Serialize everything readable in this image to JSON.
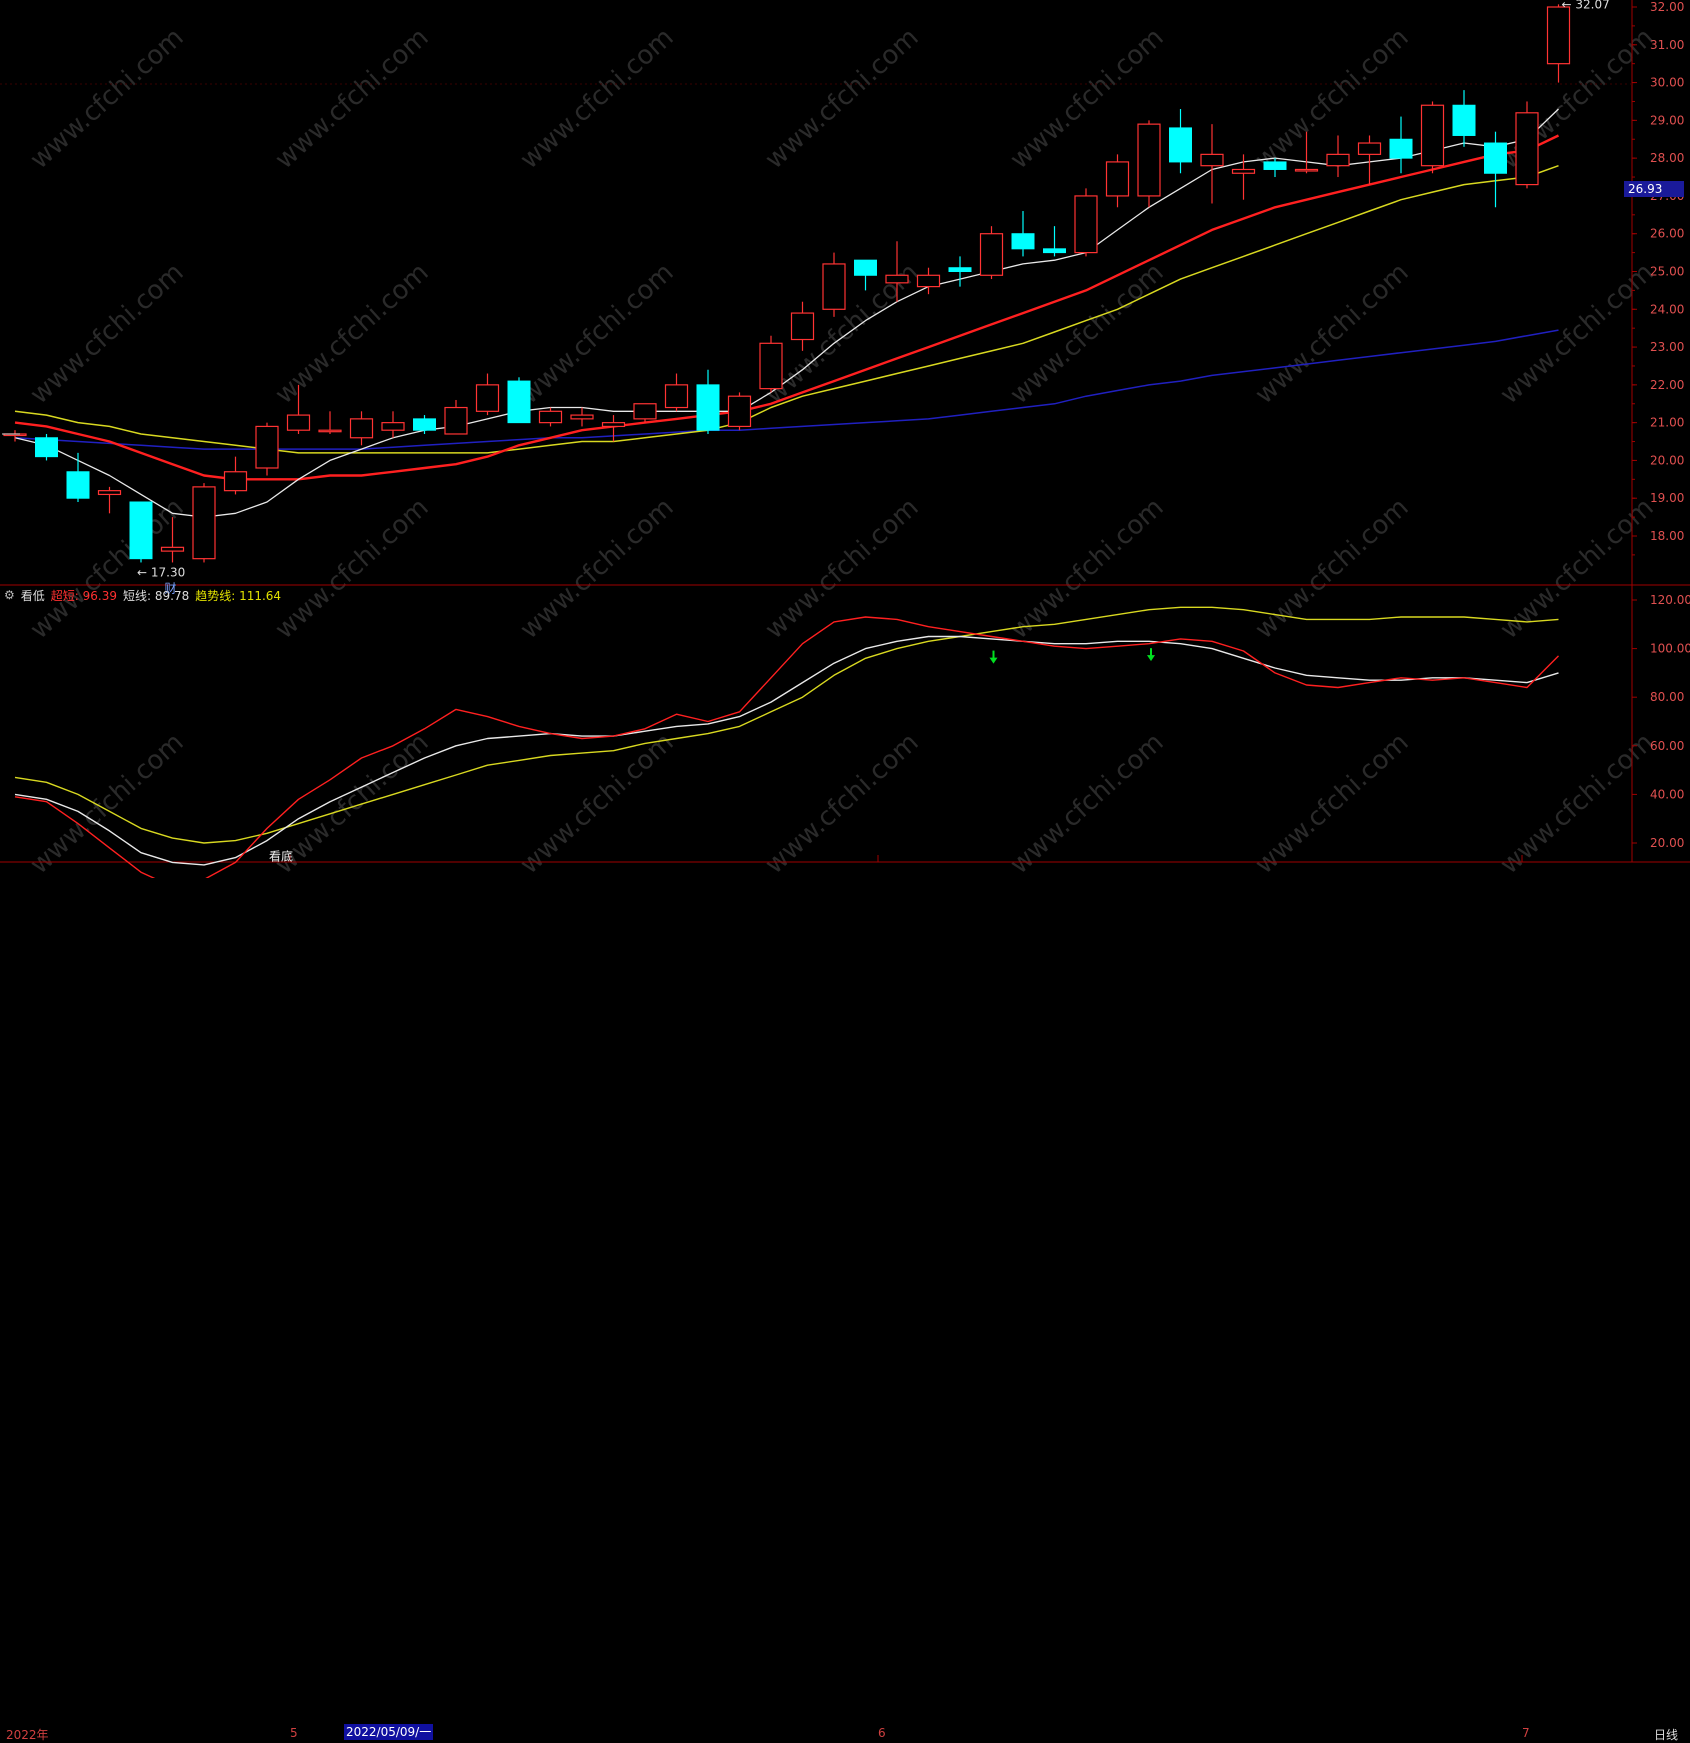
{
  "indicator_header": {
    "gear_icon": "gear-icon",
    "name": "看低",
    "super_short_label": "超短: 96.39",
    "short_label": "短线: 89.78",
    "trend_label": "趋势线: 111.64"
  },
  "bottom_bar": {
    "year_label": "2022年",
    "month5": "5",
    "cursor_date": "2022/05/09/一",
    "month6": "6",
    "month7": "7",
    "period": "日线"
  },
  "price_tag": "26.93",
  "annotations": {
    "high_label": "32.07",
    "low_label": "17.30",
    "fin_marker": "财",
    "bottom_signal": "看底"
  },
  "watermark": "www.cfchi.com",
  "colors": {
    "up": "#ff3333",
    "down": "#00ffff",
    "ma_white": "#e8e8e8",
    "ma_red": "#ff2020",
    "ma_yellow": "#d8d820",
    "ma_blue": "#2020c0",
    "axis": "#aa0000",
    "signal_arrow": "#00e020"
  },
  "chart_data": [
    {
      "type": "candlestick",
      "ylim": [
        17.0,
        32.1
      ],
      "yticks": [
        "18.00",
        "19.00",
        "20.00",
        "21.00",
        "22.00",
        "23.00",
        "24.00",
        "25.00",
        "26.00",
        "27.00",
        "28.00",
        "29.00",
        "30.00",
        "31.00",
        "32.00"
      ],
      "candles": [
        [
          20.7,
          20.8,
          20.5,
          20.7
        ],
        [
          20.6,
          20.7,
          20.0,
          20.1
        ],
        [
          19.7,
          20.2,
          18.9,
          19.0
        ],
        [
          19.1,
          19.3,
          18.6,
          19.2
        ],
        [
          18.9,
          18.9,
          17.3,
          17.4
        ],
        [
          17.6,
          18.5,
          17.3,
          17.7
        ],
        [
          17.4,
          19.4,
          17.3,
          19.3
        ],
        [
          19.2,
          20.1,
          19.1,
          19.7
        ],
        [
          19.8,
          21.0,
          19.6,
          20.9
        ],
        [
          20.8,
          22.0,
          20.7,
          21.2
        ],
        [
          20.8,
          21.3,
          20.7,
          20.8
        ],
        [
          20.6,
          21.3,
          20.4,
          21.1
        ],
        [
          20.8,
          21.3,
          20.6,
          21.0
        ],
        [
          21.1,
          21.2,
          20.7,
          20.8
        ],
        [
          20.7,
          21.6,
          20.7,
          21.4
        ],
        [
          21.3,
          22.3,
          21.2,
          22.0
        ],
        [
          22.1,
          22.2,
          21.0,
          21.0
        ],
        [
          21.0,
          21.4,
          20.9,
          21.3
        ],
        [
          21.1,
          21.4,
          20.9,
          21.2
        ],
        [
          20.9,
          21.2,
          20.5,
          21.0
        ],
        [
          21.1,
          21.5,
          21.0,
          21.5
        ],
        [
          21.4,
          22.3,
          21.3,
          22.0
        ],
        [
          22.0,
          22.4,
          20.7,
          20.8
        ],
        [
          20.9,
          21.8,
          20.8,
          21.7
        ],
        [
          21.9,
          23.3,
          21.8,
          23.1
        ],
        [
          23.2,
          24.2,
          22.9,
          23.9
        ],
        [
          24.0,
          25.5,
          23.8,
          25.2
        ],
        [
          25.3,
          25.3,
          24.5,
          24.9
        ],
        [
          24.7,
          25.8,
          24.2,
          24.9
        ],
        [
          24.6,
          25.1,
          24.4,
          24.9
        ],
        [
          25.1,
          25.4,
          24.6,
          25.0
        ],
        [
          24.9,
          26.2,
          24.8,
          26.0
        ],
        [
          26.0,
          26.6,
          25.4,
          25.6
        ],
        [
          25.6,
          26.2,
          25.4,
          25.5
        ],
        [
          25.5,
          27.2,
          25.4,
          27.0
        ],
        [
          27.0,
          28.1,
          26.7,
          27.9
        ],
        [
          27.0,
          29.0,
          26.7,
          28.9
        ],
        [
          28.8,
          29.3,
          27.6,
          27.9
        ],
        [
          27.8,
          28.9,
          26.8,
          28.1
        ],
        [
          27.6,
          28.1,
          26.9,
          27.7
        ],
        [
          27.9,
          28.0,
          27.5,
          27.7
        ],
        [
          27.7,
          28.7,
          27.6,
          27.7
        ],
        [
          27.8,
          28.6,
          27.5,
          28.1
        ],
        [
          28.1,
          28.6,
          27.3,
          28.4
        ],
        [
          28.5,
          29.1,
          27.6,
          28.0
        ],
        [
          27.8,
          29.5,
          27.6,
          29.4
        ],
        [
          29.4,
          29.8,
          28.3,
          28.6
        ],
        [
          28.4,
          28.7,
          26.7,
          27.6
        ],
        [
          27.3,
          29.5,
          27.2,
          29.2
        ],
        [
          30.5,
          32.07,
          30.0,
          32.0
        ]
      ],
      "ma_white": [
        20.6,
        20.4,
        20.0,
        19.6,
        19.1,
        18.6,
        18.5,
        18.6,
        18.9,
        19.5,
        20.0,
        20.3,
        20.6,
        20.8,
        20.9,
        21.1,
        21.3,
        21.4,
        21.4,
        21.3,
        21.3,
        21.3,
        21.3,
        21.3,
        21.8,
        22.4,
        23.1,
        23.7,
        24.2,
        24.6,
        24.8,
        25.0,
        25.2,
        25.3,
        25.5,
        26.1,
        26.7,
        27.2,
        27.7,
        27.9,
        28.0,
        27.9,
        27.8,
        27.9,
        28.0,
        28.2,
        28.4,
        28.3,
        28.5,
        29.3
      ],
      "ma_red": [
        21.0,
        20.9,
        20.7,
        20.5,
        20.2,
        19.9,
        19.6,
        19.5,
        19.5,
        19.5,
        19.6,
        19.6,
        19.7,
        19.8,
        19.9,
        20.1,
        20.4,
        20.6,
        20.8,
        20.9,
        21.0,
        21.1,
        21.2,
        21.3,
        21.5,
        21.8,
        22.1,
        22.4,
        22.7,
        23.0,
        23.3,
        23.6,
        23.9,
        24.2,
        24.5,
        24.9,
        25.3,
        25.7,
        26.1,
        26.4,
        26.7,
        26.9,
        27.1,
        27.3,
        27.5,
        27.7,
        27.9,
        28.1,
        28.2,
        28.6
      ],
      "ma_yellow": [
        21.3,
        21.2,
        21.0,
        20.9,
        20.7,
        20.6,
        20.5,
        20.4,
        20.3,
        20.2,
        20.2,
        20.2,
        20.2,
        20.2,
        20.2,
        20.2,
        20.3,
        20.4,
        20.5,
        20.5,
        20.6,
        20.7,
        20.8,
        21.0,
        21.4,
        21.7,
        21.9,
        22.1,
        22.3,
        22.5,
        22.7,
        22.9,
        23.1,
        23.4,
        23.7,
        24.0,
        24.4,
        24.8,
        25.1,
        25.4,
        25.7,
        26.0,
        26.3,
        26.6,
        26.9,
        27.1,
        27.3,
        27.4,
        27.5,
        27.8
      ],
      "ma_blue": [
        20.6,
        20.55,
        20.5,
        20.45,
        20.4,
        20.35,
        20.3,
        20.3,
        20.3,
        20.3,
        20.3,
        20.3,
        20.35,
        20.4,
        20.45,
        20.5,
        20.55,
        20.6,
        20.6,
        20.65,
        20.7,
        20.75,
        20.8,
        20.8,
        20.85,
        20.9,
        20.95,
        21.0,
        21.05,
        21.1,
        21.2,
        21.3,
        21.4,
        21.5,
        21.7,
        21.85,
        22.0,
        22.1,
        22.25,
        22.35,
        22.45,
        22.55,
        22.65,
        22.75,
        22.85,
        22.95,
        23.05,
        23.15,
        23.3,
        23.45
      ]
    },
    {
      "type": "line",
      "ylim": [
        0,
        122
      ],
      "yticks": [
        "20.00",
        "40.00",
        "60.00",
        "80.00",
        "100.00",
        "120.00"
      ],
      "series": [
        {
          "name": "超短",
          "color": "#ff2020",
          "values": [
            39,
            37,
            28,
            18,
            8,
            2,
            5,
            12,
            26,
            38,
            46,
            55,
            60,
            67,
            75,
            72,
            68,
            65,
            63,
            64,
            67,
            73,
            70,
            74,
            88,
            102,
            111,
            113,
            112,
            109,
            107,
            105,
            103,
            101,
            100,
            101,
            102,
            104,
            103,
            99,
            90,
            85,
            84,
            86,
            88,
            87,
            88,
            86,
            84,
            97
          ]
        },
        {
          "name": "短线",
          "color": "#e8e8e8",
          "values": [
            40,
            38,
            33,
            25,
            16,
            12,
            11,
            14,
            21,
            30,
            37,
            43,
            49,
            55,
            60,
            63,
            64,
            65,
            64,
            64,
            66,
            68,
            69,
            72,
            78,
            86,
            94,
            100,
            103,
            105,
            105,
            104,
            103,
            102,
            102,
            103,
            103,
            102,
            100,
            96,
            92,
            89,
            88,
            87,
            87,
            88,
            88,
            87,
            86,
            90
          ]
        },
        {
          "name": "趋势线",
          "color": "#d8d820",
          "values": [
            47,
            45,
            40,
            33,
            26,
            22,
            20,
            21,
            24,
            28,
            32,
            36,
            40,
            44,
            48,
            52,
            54,
            56,
            57,
            58,
            61,
            63,
            65,
            68,
            74,
            80,
            89,
            96,
            100,
            103,
            105,
            107,
            109,
            110,
            112,
            114,
            116,
            117,
            117,
            116,
            114,
            112,
            112,
            112,
            113,
            113,
            113,
            112,
            111,
            112
          ]
        }
      ]
    }
  ]
}
